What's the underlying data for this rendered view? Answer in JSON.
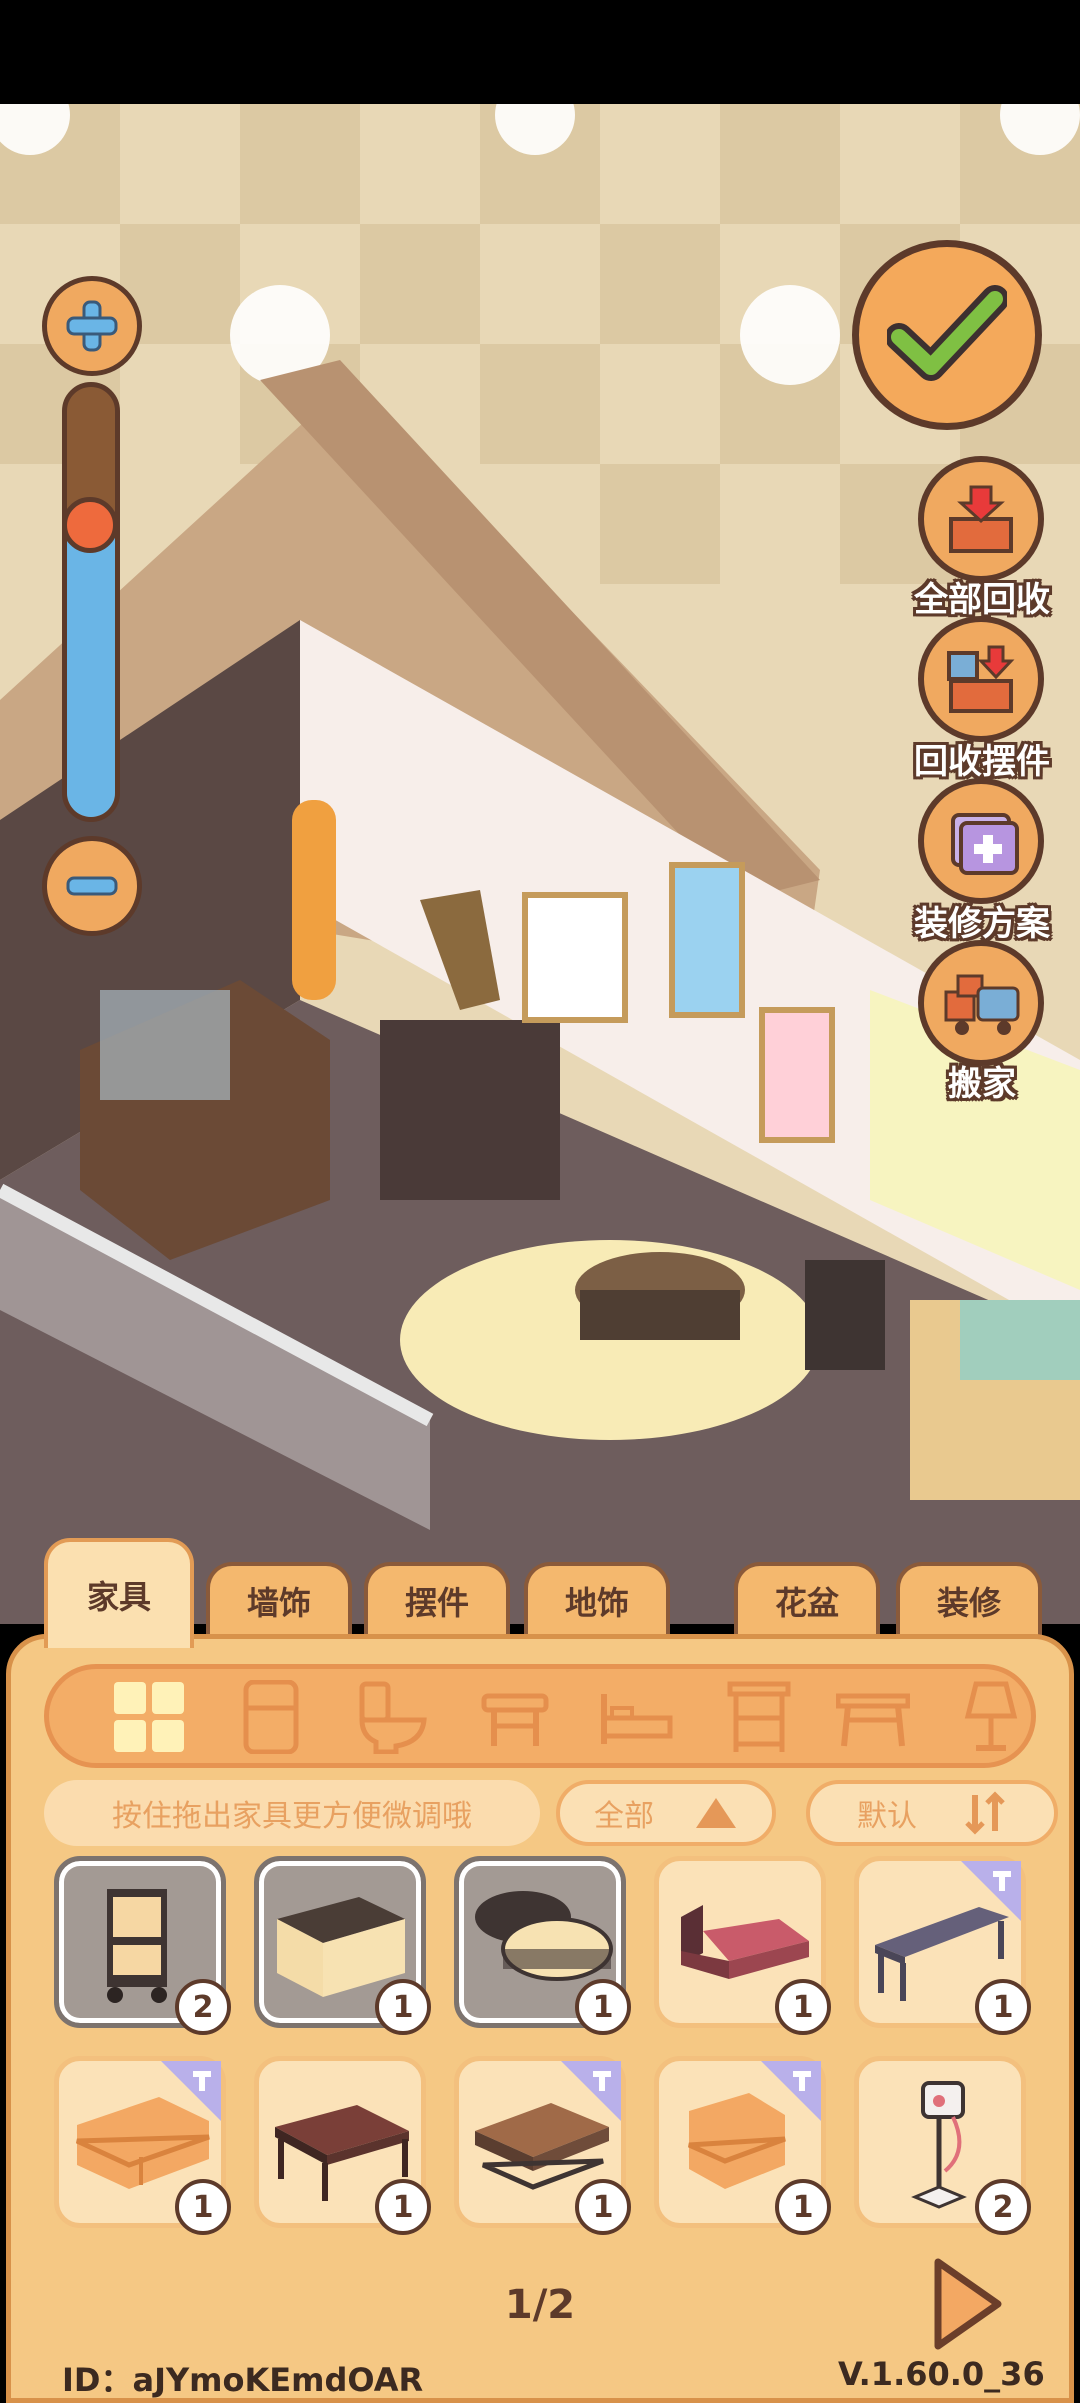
{
  "scene": {
    "wall_color": "#f7eeea",
    "floor_color": "#6e5d5d",
    "rug_color": "#f8ebb6"
  },
  "sidebar": {
    "items": [
      {
        "label": "全部回收",
        "icon": "box-down-arrow-icon"
      },
      {
        "label": "回收摆件",
        "icon": "cup-box-icon"
      },
      {
        "label": "装修方案",
        "icon": "folder-plus-icon"
      },
      {
        "label": "搬家",
        "icon": "moving-truck-icon"
      }
    ]
  },
  "zoom": {
    "level": 0.7
  },
  "tabs": [
    {
      "label": "家具",
      "active": true
    },
    {
      "label": "墙饰",
      "active": false
    },
    {
      "label": "摆件",
      "active": false
    },
    {
      "label": "地饰",
      "active": false
    },
    {
      "label": "花盆",
      "active": false
    },
    {
      "label": "装修",
      "active": false
    }
  ],
  "categories": [
    "grid-all-icon",
    "fridge-icon",
    "toilet-icon",
    "stool-icon",
    "bed-icon",
    "cabinet-icon",
    "table-icon",
    "lamp-icon"
  ],
  "filter": {
    "hint": "按住拖出家具更方便微调哦",
    "type_select": "全部",
    "sort_select": "默认"
  },
  "items": [
    {
      "name": "trolley-cart",
      "count": "2",
      "owned_style": true,
      "ribbon": false
    },
    {
      "name": "sideboard",
      "count": "1",
      "owned_style": true,
      "ribbon": false
    },
    {
      "name": "round-table",
      "count": "1",
      "owned_style": true,
      "ribbon": false
    },
    {
      "name": "red-bed",
      "count": "1",
      "owned_style": false,
      "ribbon": false
    },
    {
      "name": "bench",
      "count": "1",
      "owned_style": false,
      "ribbon": true
    },
    {
      "name": "orange-sofa",
      "count": "1",
      "owned_style": false,
      "ribbon": true
    },
    {
      "name": "dark-table",
      "count": "1",
      "owned_style": false,
      "ribbon": false
    },
    {
      "name": "coffee-table",
      "count": "1",
      "owned_style": false,
      "ribbon": true
    },
    {
      "name": "armchair",
      "count": "1",
      "owned_style": false,
      "ribbon": true
    },
    {
      "name": "fan-stand",
      "count": "2",
      "owned_style": false,
      "ribbon": false
    }
  ],
  "pagination": {
    "current": "1/2"
  },
  "footer": {
    "user_id": "ID：aJYmoKEmdOAR",
    "version": "V.1.60.0_36"
  }
}
